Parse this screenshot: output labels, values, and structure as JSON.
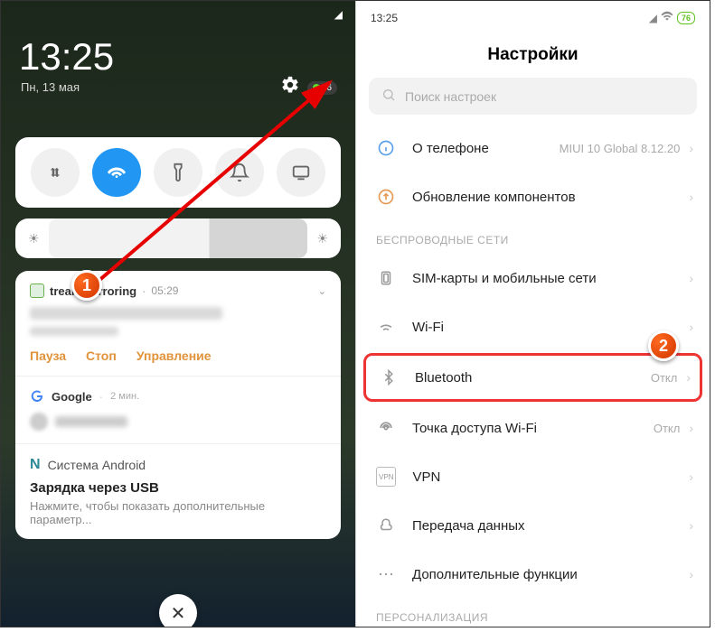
{
  "left": {
    "statusbar_time": "",
    "clock": "13:25",
    "date": "Пн, 13 мая",
    "battery": "76",
    "toggles": [
      "data",
      "wifi",
      "flashlight",
      "bell",
      "cast"
    ],
    "notif1": {
      "app": "tream Mirroring",
      "time": "05:29",
      "actions": {
        "pause": "Пауза",
        "stop": "Стоп",
        "control": "Управление"
      }
    },
    "notif2": {
      "app": "Google",
      "time": "2 мин."
    },
    "notif3": {
      "system": "Система Android",
      "title": "Зарядка через USB",
      "sub": "Нажмите, чтобы показать дополнительные параметр..."
    }
  },
  "right": {
    "statusbar_time": "13:25",
    "battery": "76",
    "title": "Настройки",
    "search_placeholder": "Поиск настроек",
    "rows": {
      "about": {
        "label": "О телефоне",
        "value": "MIUI 10 Global 8.12.20"
      },
      "update": {
        "label": "Обновление компонентов"
      },
      "section_wireless": "БЕСПРОВОДНЫЕ СЕТИ",
      "sim": {
        "label": "SIM-карты и мобильные сети"
      },
      "wifi": {
        "label": "Wi-Fi"
      },
      "bluetooth": {
        "label": "Bluetooth",
        "value": "Откл"
      },
      "hotspot": {
        "label": "Точка доступа Wi-Fi",
        "value": "Откл"
      },
      "vpn": {
        "label": "VPN"
      },
      "dataxfer": {
        "label": "Передача данных"
      },
      "more": {
        "label": "Дополнительные функции"
      },
      "section_personal": "ПЕРСОНАЛИЗАЦИЯ"
    }
  },
  "markers": {
    "one": "1",
    "two": "2"
  }
}
